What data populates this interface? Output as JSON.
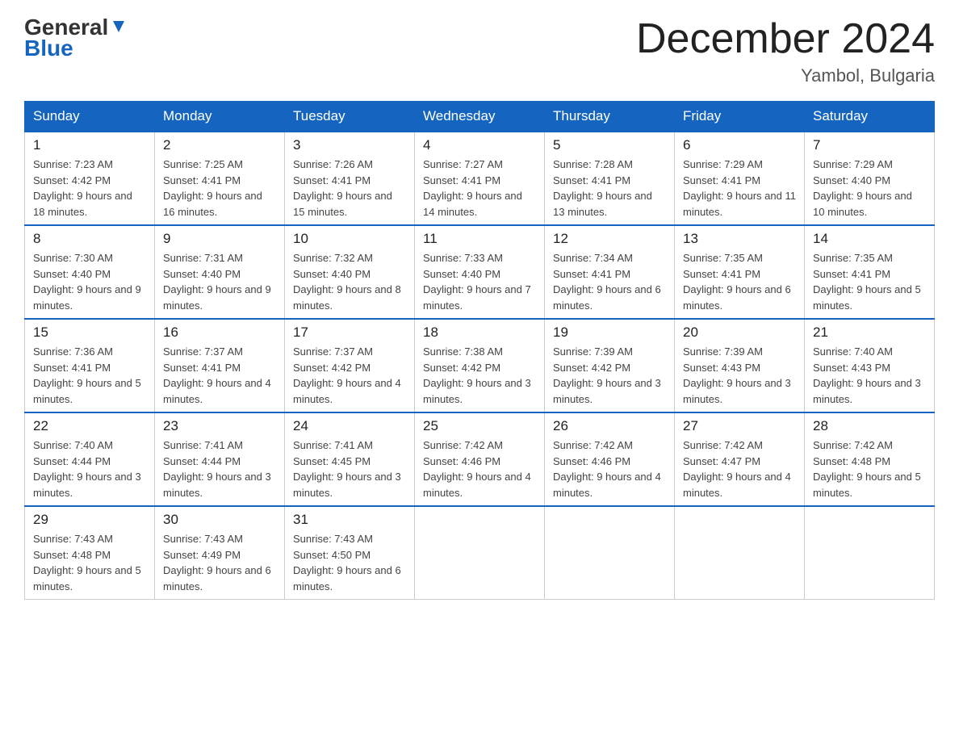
{
  "header": {
    "logo_line1": "General",
    "logo_line2": "Blue",
    "month_title": "December 2024",
    "location": "Yambol, Bulgaria"
  },
  "weekdays": [
    "Sunday",
    "Monday",
    "Tuesday",
    "Wednesday",
    "Thursday",
    "Friday",
    "Saturday"
  ],
  "weeks": [
    [
      {
        "day": "1",
        "sunrise": "7:23 AM",
        "sunset": "4:42 PM",
        "daylight": "9 hours and 18 minutes."
      },
      {
        "day": "2",
        "sunrise": "7:25 AM",
        "sunset": "4:41 PM",
        "daylight": "9 hours and 16 minutes."
      },
      {
        "day": "3",
        "sunrise": "7:26 AM",
        "sunset": "4:41 PM",
        "daylight": "9 hours and 15 minutes."
      },
      {
        "day": "4",
        "sunrise": "7:27 AM",
        "sunset": "4:41 PM",
        "daylight": "9 hours and 14 minutes."
      },
      {
        "day": "5",
        "sunrise": "7:28 AM",
        "sunset": "4:41 PM",
        "daylight": "9 hours and 13 minutes."
      },
      {
        "day": "6",
        "sunrise": "7:29 AM",
        "sunset": "4:41 PM",
        "daylight": "9 hours and 11 minutes."
      },
      {
        "day": "7",
        "sunrise": "7:29 AM",
        "sunset": "4:40 PM",
        "daylight": "9 hours and 10 minutes."
      }
    ],
    [
      {
        "day": "8",
        "sunrise": "7:30 AM",
        "sunset": "4:40 PM",
        "daylight": "9 hours and 9 minutes."
      },
      {
        "day": "9",
        "sunrise": "7:31 AM",
        "sunset": "4:40 PM",
        "daylight": "9 hours and 9 minutes."
      },
      {
        "day": "10",
        "sunrise": "7:32 AM",
        "sunset": "4:40 PM",
        "daylight": "9 hours and 8 minutes."
      },
      {
        "day": "11",
        "sunrise": "7:33 AM",
        "sunset": "4:40 PM",
        "daylight": "9 hours and 7 minutes."
      },
      {
        "day": "12",
        "sunrise": "7:34 AM",
        "sunset": "4:41 PM",
        "daylight": "9 hours and 6 minutes."
      },
      {
        "day": "13",
        "sunrise": "7:35 AM",
        "sunset": "4:41 PM",
        "daylight": "9 hours and 6 minutes."
      },
      {
        "day": "14",
        "sunrise": "7:35 AM",
        "sunset": "4:41 PM",
        "daylight": "9 hours and 5 minutes."
      }
    ],
    [
      {
        "day": "15",
        "sunrise": "7:36 AM",
        "sunset": "4:41 PM",
        "daylight": "9 hours and 5 minutes."
      },
      {
        "day": "16",
        "sunrise": "7:37 AM",
        "sunset": "4:41 PM",
        "daylight": "9 hours and 4 minutes."
      },
      {
        "day": "17",
        "sunrise": "7:37 AM",
        "sunset": "4:42 PM",
        "daylight": "9 hours and 4 minutes."
      },
      {
        "day": "18",
        "sunrise": "7:38 AM",
        "sunset": "4:42 PM",
        "daylight": "9 hours and 3 minutes."
      },
      {
        "day": "19",
        "sunrise": "7:39 AM",
        "sunset": "4:42 PM",
        "daylight": "9 hours and 3 minutes."
      },
      {
        "day": "20",
        "sunrise": "7:39 AM",
        "sunset": "4:43 PM",
        "daylight": "9 hours and 3 minutes."
      },
      {
        "day": "21",
        "sunrise": "7:40 AM",
        "sunset": "4:43 PM",
        "daylight": "9 hours and 3 minutes."
      }
    ],
    [
      {
        "day": "22",
        "sunrise": "7:40 AM",
        "sunset": "4:44 PM",
        "daylight": "9 hours and 3 minutes."
      },
      {
        "day": "23",
        "sunrise": "7:41 AM",
        "sunset": "4:44 PM",
        "daylight": "9 hours and 3 minutes."
      },
      {
        "day": "24",
        "sunrise": "7:41 AM",
        "sunset": "4:45 PM",
        "daylight": "9 hours and 3 minutes."
      },
      {
        "day": "25",
        "sunrise": "7:42 AM",
        "sunset": "4:46 PM",
        "daylight": "9 hours and 4 minutes."
      },
      {
        "day": "26",
        "sunrise": "7:42 AM",
        "sunset": "4:46 PM",
        "daylight": "9 hours and 4 minutes."
      },
      {
        "day": "27",
        "sunrise": "7:42 AM",
        "sunset": "4:47 PM",
        "daylight": "9 hours and 4 minutes."
      },
      {
        "day": "28",
        "sunrise": "7:42 AM",
        "sunset": "4:48 PM",
        "daylight": "9 hours and 5 minutes."
      }
    ],
    [
      {
        "day": "29",
        "sunrise": "7:43 AM",
        "sunset": "4:48 PM",
        "daylight": "9 hours and 5 minutes."
      },
      {
        "day": "30",
        "sunrise": "7:43 AM",
        "sunset": "4:49 PM",
        "daylight": "9 hours and 6 minutes."
      },
      {
        "day": "31",
        "sunrise": "7:43 AM",
        "sunset": "4:50 PM",
        "daylight": "9 hours and 6 minutes."
      },
      null,
      null,
      null,
      null
    ]
  ]
}
